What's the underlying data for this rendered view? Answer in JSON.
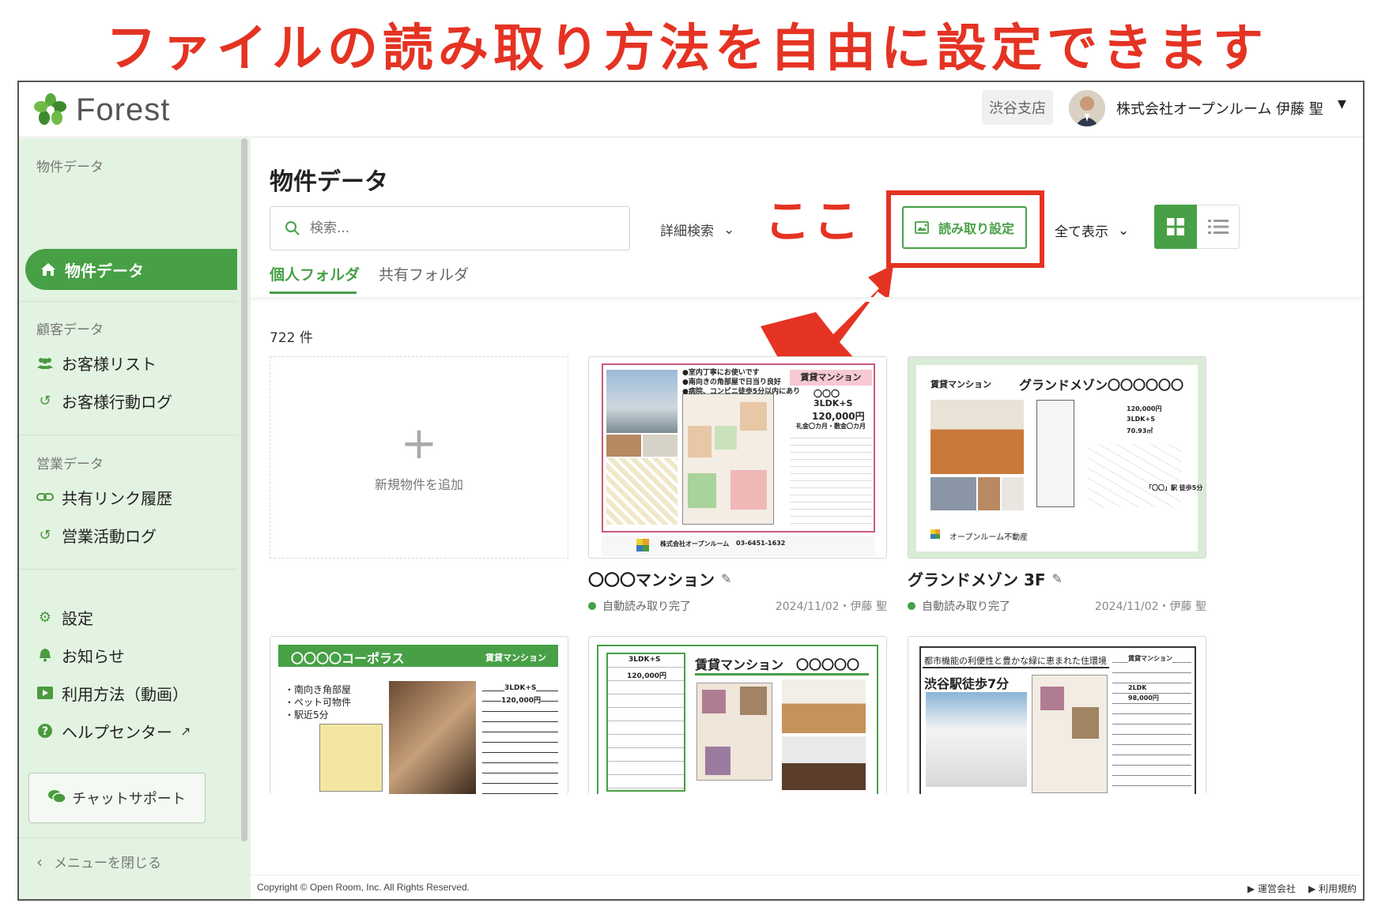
{
  "headline": "ファイルの読み取り方法を自由に設定できます",
  "annotation": "ここ",
  "topbar": {
    "logo_text": "Forest",
    "branch": "渋谷支店",
    "user_name": "株式会社オープンルーム 伊藤 聖"
  },
  "sidebar": {
    "group_property": "物件データ",
    "item_property": "物件データ",
    "group_customer": "顧客データ",
    "item_customer_list": "お客様リスト",
    "item_customer_log": "お客様行動ログ",
    "group_sales": "営業データ",
    "item_share_history": "共有リンク履歴",
    "item_sales_log": "営業活動ログ",
    "item_settings": "設定",
    "item_notice": "お知らせ",
    "item_howto": "利用方法（動画）",
    "item_help": "ヘルプセンター",
    "chat_support": "チャットサポート",
    "close_menu": "メニューを閉じる"
  },
  "main": {
    "title": "物件データ",
    "search_placeholder": "検索...",
    "advanced_search": "詳細検索",
    "read_settings": "読み取り設定",
    "show_all": "全て表示",
    "tab_personal": "個人フォルダ",
    "tab_shared": "共有フォルダ",
    "count": "722 件",
    "add_property": "新規物件を追加"
  },
  "cards": [
    {
      "title": "〇〇〇マンション",
      "status": "自動読み取り完了",
      "date": "2024/11/02・伊藤 聖",
      "flyer": {
        "bullets": [
          "●室内丁寧にお使いです",
          "●南向きの角部屋で日当り良好",
          "●病院、コンビニ徒歩5分以内にあり"
        ],
        "badge": "賃貸マンション",
        "name": "〇〇〇",
        "layout": "3LDK+S",
        "rent": "120,000円",
        "deposit": "礼金〇カ月・敷金〇カ月",
        "company": "株式会社オープンルーム",
        "tel": "03-6451-1632"
      }
    },
    {
      "title": "グランドメゾン 3F",
      "status": "自動読み取り完了",
      "date": "2024/11/02・伊藤 聖",
      "flyer": {
        "badge": "賃貸マンション",
        "name": "グランドメゾン〇〇〇〇〇〇",
        "rent": "120,000円",
        "layout": "3LDK+S",
        "area": "70.93㎡",
        "station": "「〇〇」駅 徒歩5分",
        "company": "オープンルーム不動産"
      }
    },
    {
      "flyer": {
        "name": "〇〇〇〇コーポラス",
        "badge": "賃貸マンション",
        "bullets": [
          "・南向き角部屋",
          "・ペット可物件",
          "・駅近5分"
        ],
        "layout": "3LDK+S",
        "rent": "120,000円"
      }
    },
    {
      "flyer": {
        "layout": "3LDK+S",
        "rent": "120,000円",
        "badge": "賃貸マンション",
        "name": "〇〇〇〇〇"
      }
    },
    {
      "flyer": {
        "catch": "都市機能の利便性と豊かな緑に恵まれた住環境",
        "station": "渋谷駅徒歩7分",
        "badge": "賃貸マンション",
        "layout": "2LDK",
        "rent": "98,000円"
      }
    }
  ],
  "footer": {
    "copyright": "Copyright © Open Room, Inc. All Rights Reserved.",
    "company_link": "▶ 運営会社",
    "terms_link": "▶ 利用規約"
  },
  "colors": {
    "brand_green": "#47a046",
    "sidebar_bg": "#e3f3e1",
    "annotation_red": "#e53323"
  }
}
